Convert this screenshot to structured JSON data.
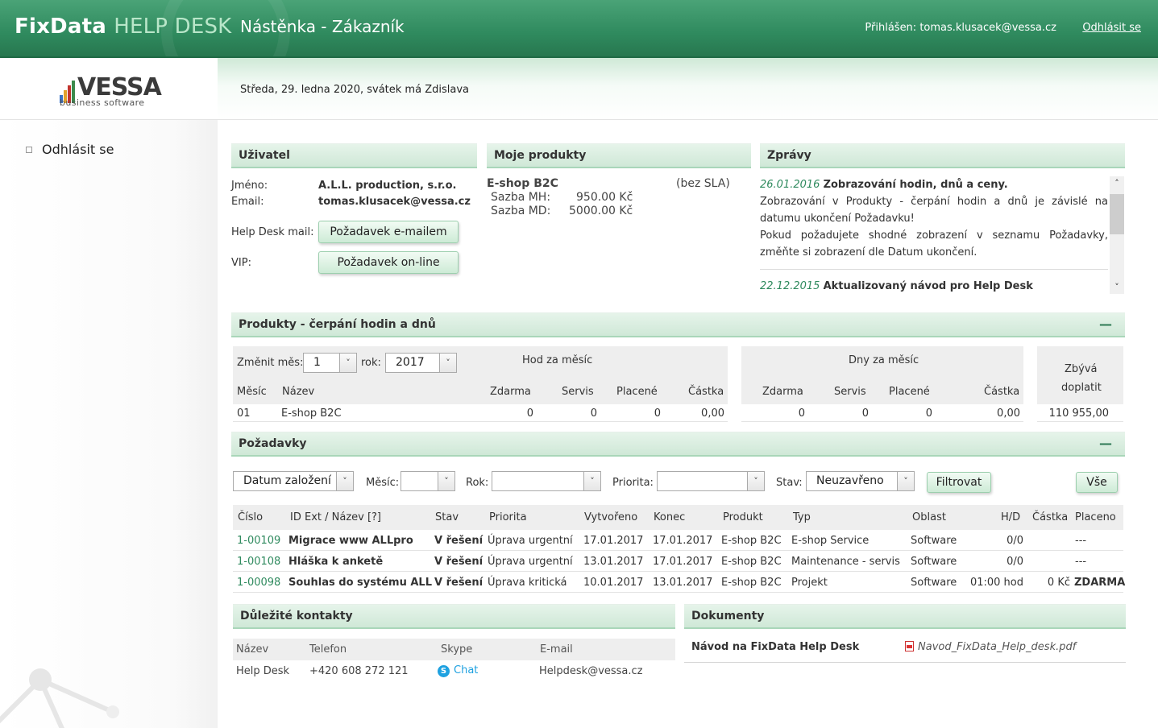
{
  "header": {
    "brand_main": "FixData",
    "brand_accent": "HELP DESK",
    "page_title": "Nástěnka - Zákazník",
    "login_info": "Přihlášen: tomas.klusacek@vessa.cz",
    "logout_link": "Odhlásit se"
  },
  "logo": {
    "name": "VESSA",
    "tagline": "business software"
  },
  "date_line": "Středa, 29. ledna 2020, svátek má Zdislava",
  "sidebar": {
    "items": [
      {
        "label": "Odhlásit se"
      }
    ]
  },
  "user_panel": {
    "title": "Uživatel",
    "name_label": "Jméno:",
    "name_value": "A.L.L. production, s.r.o.",
    "email_label": "Email:",
    "email_value": "tomas.klusacek@vessa.cz",
    "helpdesk_label": "Help Desk mail:",
    "email_request_button": "Požadavek e-mailem",
    "vip_label": "VIP:",
    "online_request_button": "Požadavek on-line"
  },
  "products_panel": {
    "title": "Moje produkty",
    "product_name": "E-shop B2C",
    "sla": "(bez SLA)",
    "rate_mh_label": "Sazba MH:",
    "rate_mh_value": "950.00 Kč",
    "rate_md_label": "Sazba MD:",
    "rate_md_value": "5000.00 Kč"
  },
  "news_panel": {
    "title": "Zprávy",
    "items": [
      {
        "date": "26.01.2016",
        "title": "Zobrazování hodin, dnů a ceny.",
        "text1": "Zobrazování v Produkty - čerpání hodin a dnů je závislé na datumu ukončení Požadavku!",
        "text2": "Pokud požadujete shodné zobrazení v seznamu Požadavky, změňte si zobrazení dle Datum ukončení."
      },
      {
        "date": "22.12.2015",
        "title": "Aktualizovaný návod pro Help Desk"
      }
    ]
  },
  "usage_panel": {
    "title": "Produkty - čerpání hodin a dnů",
    "collapse": "—",
    "change_month_label": "Změnit měs:",
    "month_value": "1",
    "year_label": "rok:",
    "year_value": "2017",
    "hours_group": "Hod za měsíc",
    "days_group": "Dny za měsíc",
    "remaining_line1": "Zbývá",
    "remaining_line2": "doplatit",
    "columns": {
      "month": "Měsíc",
      "name": "Název",
      "free": "Zdarma",
      "service": "Servis",
      "paid": "Placené",
      "amount": "Částka"
    },
    "row": {
      "month": "01",
      "name": "E-shop B2C",
      "h_free": "0",
      "h_service": "0",
      "h_paid": "0",
      "h_amount": "0,00",
      "d_free": "0",
      "d_service": "0",
      "d_paid": "0",
      "d_amount": "0,00",
      "remaining": "110 955,00"
    }
  },
  "requests_panel": {
    "title": "Požadavky",
    "collapse": "—",
    "filters": {
      "date_type": "Datum založení",
      "month_label": "Měsíc:",
      "month_value": "",
      "year_label": "Rok:",
      "year_value": "",
      "priority_label": "Priorita:",
      "priority_value": "",
      "state_label": "Stav:",
      "state_value": "Neuzavřeno",
      "filter_button": "Filtrovat",
      "all_button": "Vše"
    },
    "columns": [
      "Číslo",
      "ID Ext / Název [?]",
      "Stav",
      "Priorita",
      "Vytvořeno",
      "Konec",
      "Produkt",
      "Typ",
      "Oblast",
      "H/D",
      "Částka",
      "Placeno"
    ],
    "rows": [
      {
        "id": "1-00109",
        "name": "Migrace www ALLpro",
        "state": "V řešení",
        "priority": "Úprava urgentní",
        "created": "17.01.2017",
        "end": "17.01.2017",
        "product": "E-shop B2C",
        "type": "E-shop Service",
        "area": "Software",
        "hd": "0/0",
        "amount": "",
        "paid": "---"
      },
      {
        "id": "1-00108",
        "name": "Hláška k anketě",
        "state": "V řešení",
        "priority": "Úprava urgentní",
        "created": "13.01.2017",
        "end": "17.01.2017",
        "product": "E-shop B2C",
        "type": "Maintenance - servis",
        "area": "Software",
        "hd": "0/0",
        "amount": "",
        "paid": "---"
      },
      {
        "id": "1-00098",
        "name": "Souhlas do systému ALL",
        "state": "V řešení",
        "priority": "Úprava kritická",
        "created": "10.01.2017",
        "end": "13.01.2017",
        "product": "E-shop B2C",
        "type": "Projekt",
        "area": "Software",
        "hd": "01:00 hod",
        "amount": "0 Kč",
        "paid": "ZDARMA"
      }
    ]
  },
  "contacts_panel": {
    "title": "Důležité kontakty",
    "columns": [
      "Název",
      "Telefon",
      "Skype",
      "E-mail"
    ],
    "rows": [
      {
        "name": "Help Desk",
        "phone": "+420 608 272 121",
        "skype": "Chat",
        "email": "Helpdesk@vessa.cz"
      }
    ]
  },
  "documents_panel": {
    "title": "Dokumenty",
    "items": [
      {
        "name": "Návod na FixData Help Desk",
        "file": "Navod_FixData_Help_desk.pdf"
      }
    ]
  },
  "colors": {
    "header_green": "#2f8a5e",
    "panel_green": "#cfe8d7",
    "link_green": "#2f8a5e"
  },
  "icons": [
    "skype-icon",
    "pdf-icon",
    "chevron-down-icon",
    "chevron-up-icon"
  ]
}
